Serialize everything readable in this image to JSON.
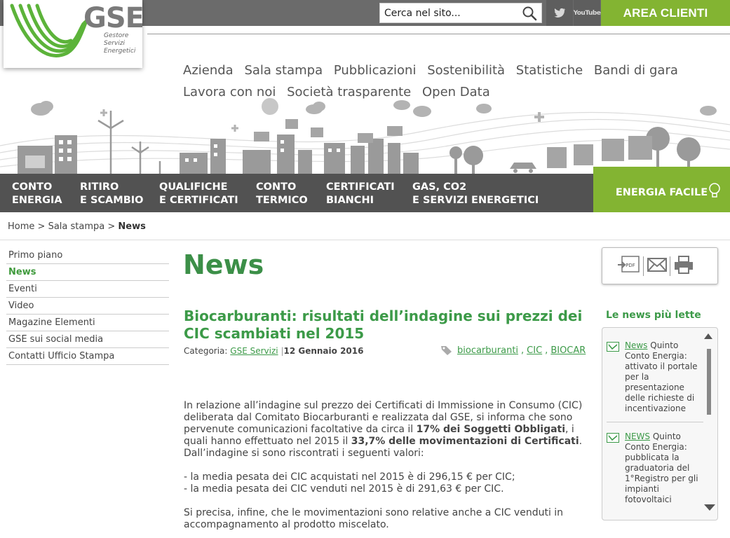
{
  "logo": {
    "name": "GSE",
    "sub": [
      "Gestore",
      "Servizi",
      "Energetici"
    ]
  },
  "search": {
    "placeholder": "Cerca nel sito..."
  },
  "social": {
    "twitter": "twitter-icon",
    "youtube": "YouTube"
  },
  "area_clienti": "AREA CLIENTI",
  "main_nav": [
    "Azienda",
    "Sala stampa",
    "Pubblicazioni",
    "Sostenibilità",
    "Statistiche",
    "Bandi di gara",
    "Lavora con noi",
    "Società trasparente",
    "Open Data"
  ],
  "dark_menu": [
    {
      "line1": "CONTO",
      "line2": "ENERGIA"
    },
    {
      "line1": "RITIRO",
      "line2": "E SCAMBIO"
    },
    {
      "line1": "QUALIFICHE",
      "line2": "E CERTIFICATI"
    },
    {
      "line1": "CONTO",
      "line2": "TERMICO"
    },
    {
      "line1": "CERTIFICATI",
      "line2": "BIANCHI"
    },
    {
      "line1": "GAS, CO2",
      "line2": "E SERVIZI ENERGETICI"
    }
  ],
  "energia_facile": "ENERGIA FACILE",
  "breadcrumb": {
    "home": "Home",
    "sep": ">",
    "section": "Sala stampa",
    "current": "News"
  },
  "left_nav": [
    "Primo piano",
    "News",
    "Eventi",
    "Video",
    "Magazine Elementi",
    "GSE sui social media",
    "Contatti Ufficio Stampa"
  ],
  "page_title": "News",
  "article": {
    "title": "Biocarburanti: risultati dell’indagine sui prezzi dei CIC scambiati nel 2015",
    "category_label": "Categoria:",
    "category": "GSE Servizi",
    "date": "12 Gennaio 2016",
    "tags": [
      "biocarburanti",
      "CIC",
      "BIOCAR"
    ],
    "p1_a": "In relazione all’indagine sul prezzo dei Certificati di Immissione in Consumo (CIC) deliberata dal Comitato Biocarburanti e realizzata dal GSE, si informa che sono pervenute comunicazioni facoltative da circa il ",
    "p1_b": "17% dei Soggetti Obbligati",
    "p1_c": ", i quali hanno effettuato nel 2015 il ",
    "p1_d": "33,7% delle movimentazioni di Certificati",
    "p1_e": ".",
    "p2": "Dall’indagine si sono riscontrati i seguenti valori:",
    "li1": "- la media pesata dei CIC acquistati nel 2015 è di 296,15 € per CIC;",
    "li2": "- la media pesata dei CIC venduti nel 2015 è di 291,63 € per CIC.",
    "p3": "Si precisa, infine, che le movimentazioni sono relative anche a CIC venduti in accompagnamento al prodotto miscelato."
  },
  "tools": {
    "pdf": "PDF"
  },
  "most_read": {
    "title": "Le news più lette",
    "items": [
      {
        "tag": "News",
        "text": " Quinto Conto Energia: attivato il portale per la presentazione delle richieste di incentivazione"
      },
      {
        "tag": "NEWS",
        "text": " Quinto Conto Energia: pubblicata la graduatoria del 1°Registro per gli impianti fotovoltaici"
      }
    ]
  },
  "colors": {
    "green": "#83b432",
    "dark_green": "#3c9a48",
    "dark_grey": "#525252"
  }
}
